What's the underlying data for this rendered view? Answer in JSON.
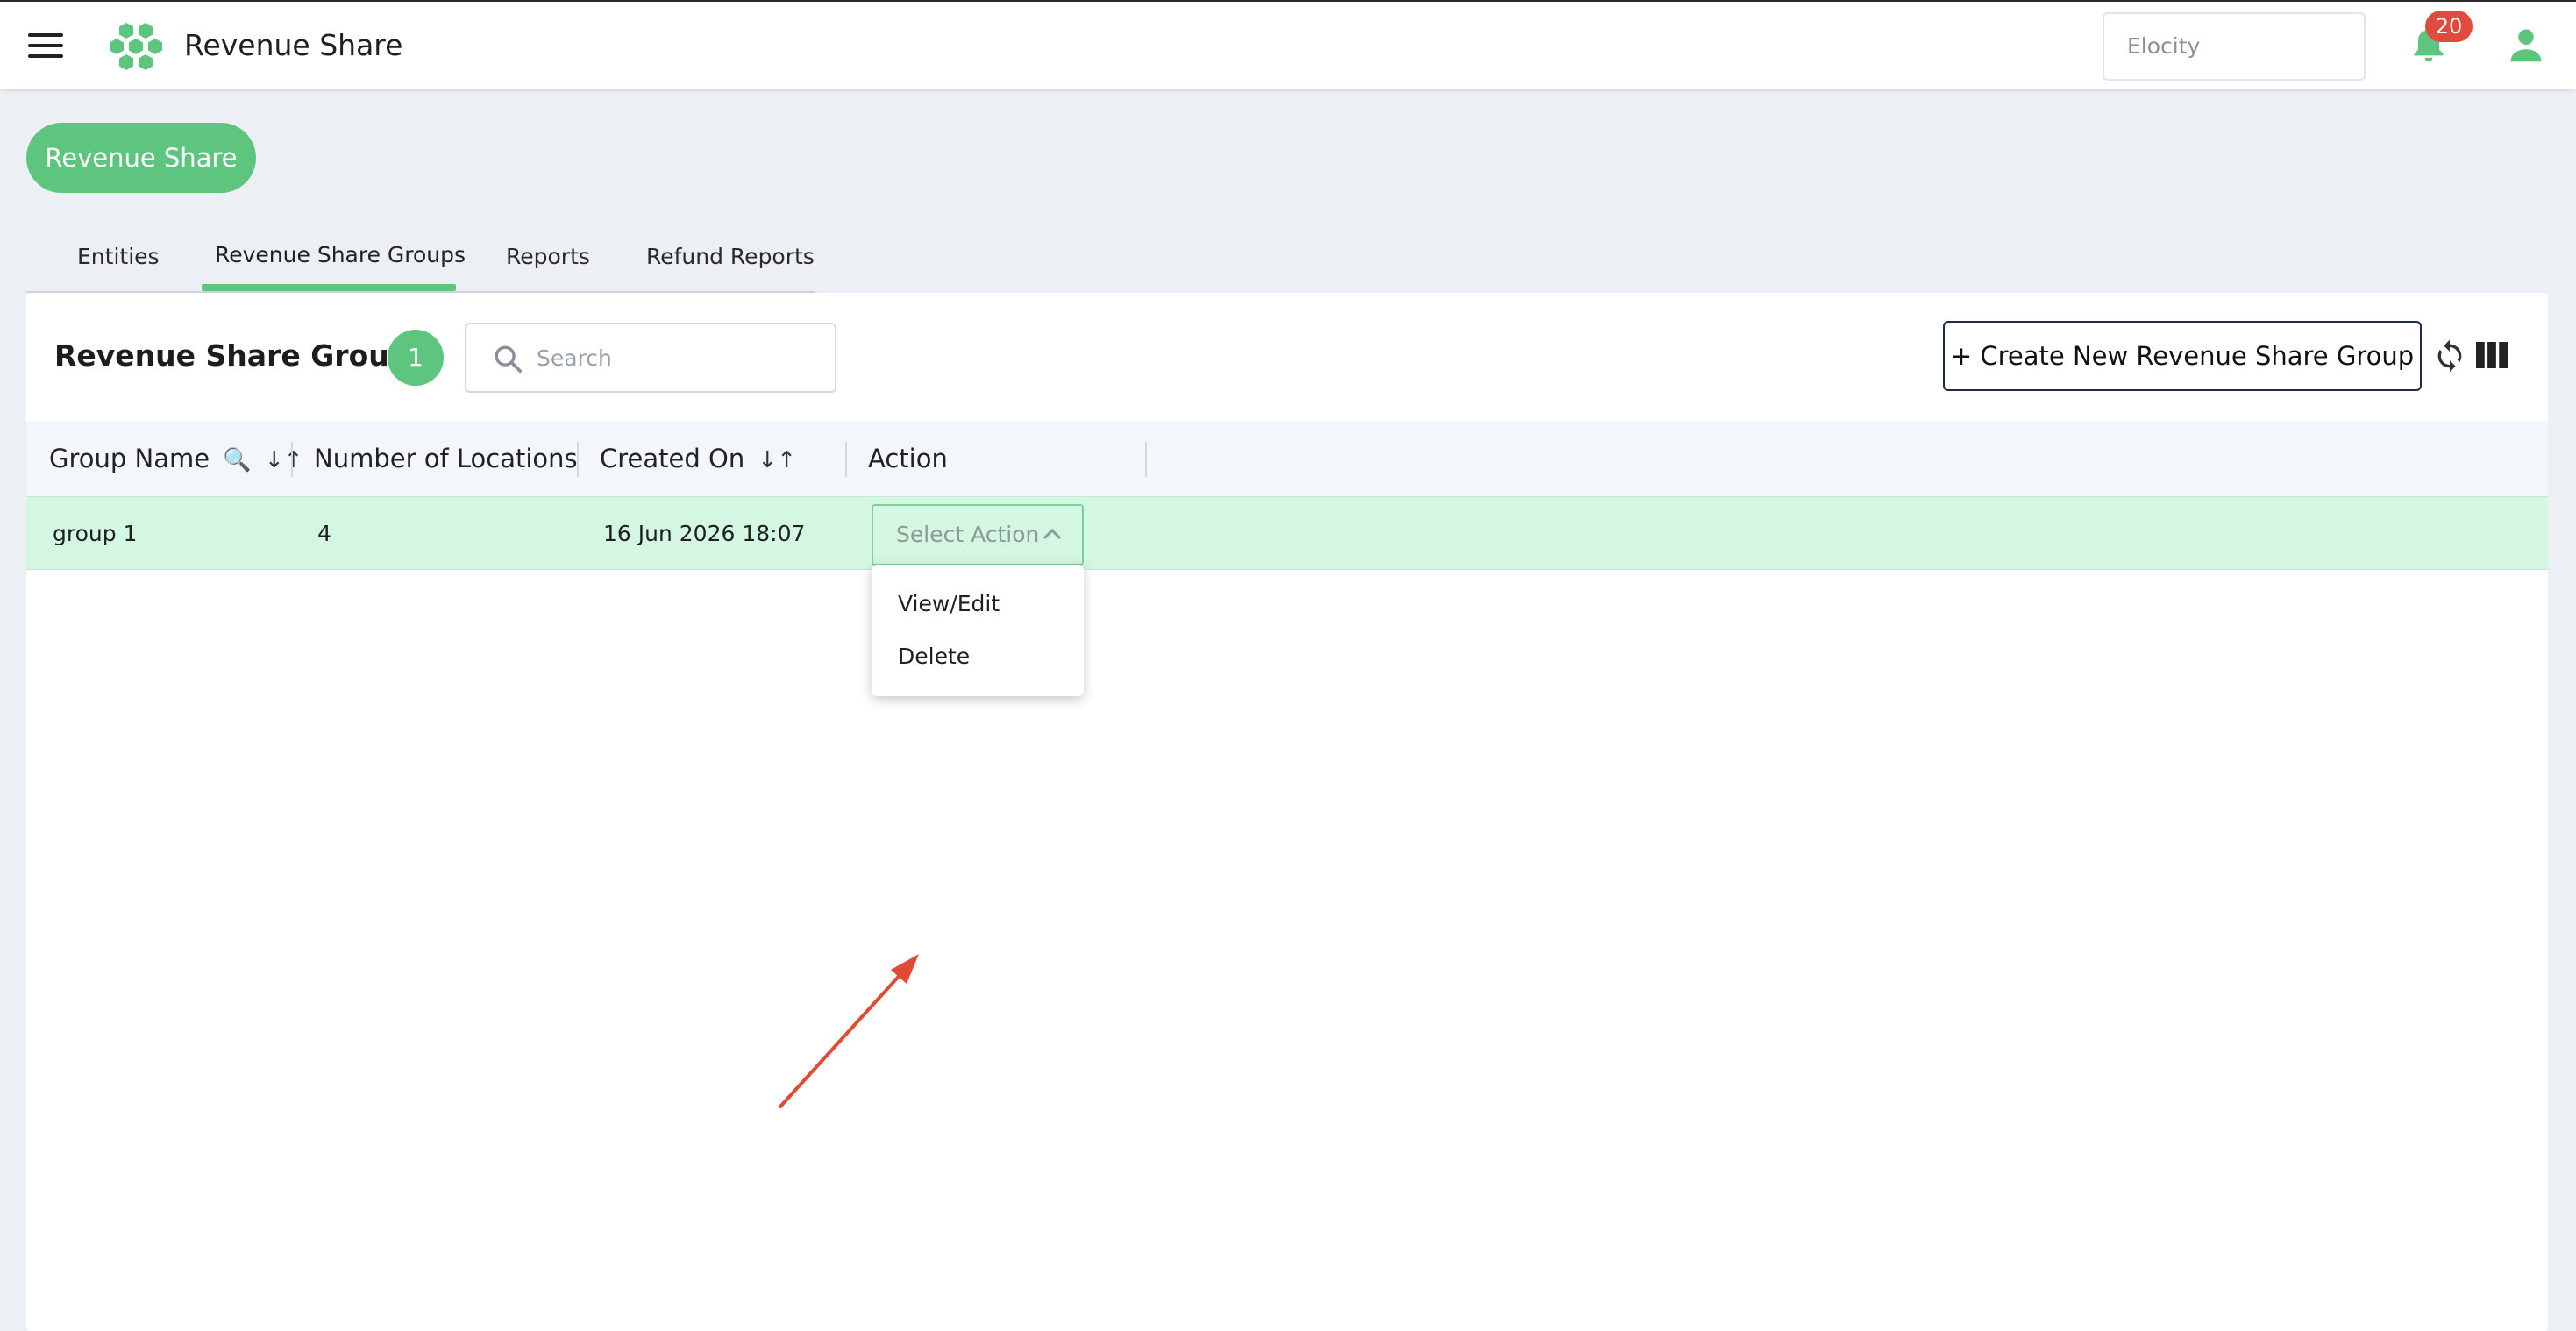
{
  "header": {
    "app_title": "Revenue Share",
    "org_selector": "Elocity",
    "notification_count": "20"
  },
  "module_button": "Revenue Share",
  "tabs": [
    {
      "label": "Entities",
      "active": false
    },
    {
      "label": "Revenue Share Groups",
      "active": true
    },
    {
      "label": "Reports",
      "active": false
    },
    {
      "label": "Refund Reports",
      "active": false
    }
  ],
  "panel": {
    "title": "Revenue Share Groups",
    "count": "1",
    "search_placeholder": "Search",
    "create_button": "+ Create New Revenue Share Group"
  },
  "table": {
    "columns": [
      "Group Name",
      "Number of Locations",
      "Created On",
      "Action"
    ],
    "sort_icon": "↓↑",
    "filter_icon": "🔍",
    "rows": [
      {
        "group_name": "group 1",
        "locations": "4",
        "created_on": "16 Jun 2026 18:07",
        "action_placeholder": "Select Action"
      }
    ]
  },
  "action_menu": {
    "items": [
      "View/Edit",
      "Delete"
    ]
  },
  "colors": {
    "accent": "#5ec57e",
    "row_highlight": "#d3f7e3",
    "badge_red": "#e04b3d",
    "arrow": "#e24a33"
  },
  "icons": {
    "menu": "hamburger-menu-icon",
    "logo": "hexagon-cluster-logo",
    "bell": "bell-icon",
    "user": "user-icon",
    "search": "search-icon",
    "refresh": "refresh-icon",
    "columns": "columns-icon",
    "chevron": "chevron-up-icon"
  }
}
